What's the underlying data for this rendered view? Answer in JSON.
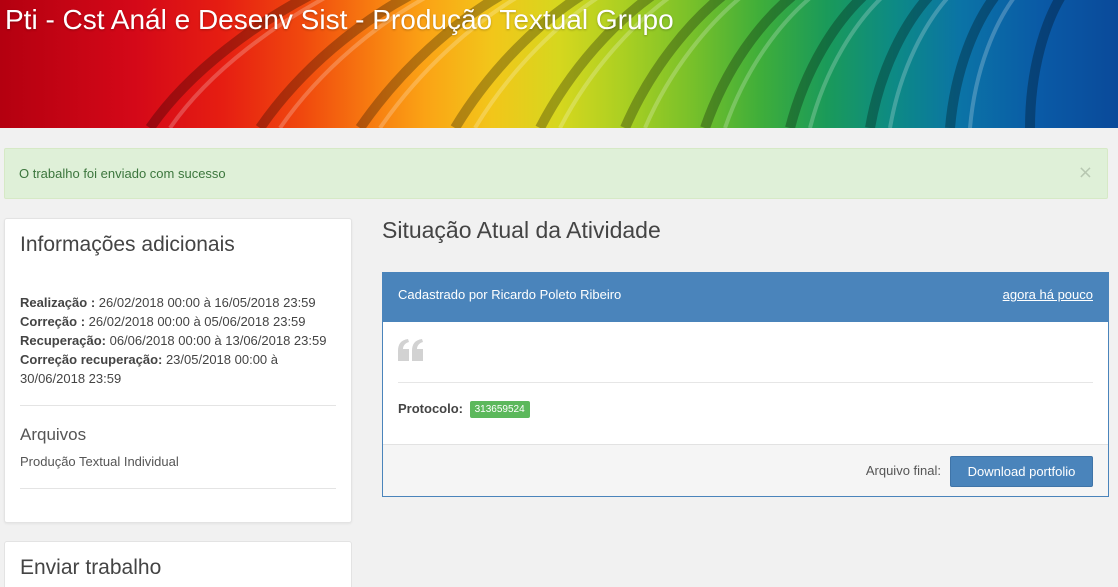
{
  "banner": {
    "title": "Pti - Cst Anál e Desenv Sist - Produção Textual Grupo"
  },
  "alert": {
    "message": "O trabalho foi enviado com sucesso",
    "close_glyph": "×"
  },
  "sidebar": {
    "info_title": "Informações adicionais",
    "dates": [
      {
        "label": "Realização :",
        "value": " 26/02/2018 00:00 à 16/05/2018 23:59"
      },
      {
        "label": "Correção :",
        "value": " 26/02/2018 00:00 à 05/06/2018 23:59"
      },
      {
        "label": "Recuperação:",
        "value": " 06/06/2018 00:00 à 13/06/2018 23:59"
      },
      {
        "label": "Correção recuperação:",
        "value": " 23/05/2018 00:00 à 30/06/2018 23:59"
      }
    ],
    "files_title": "Arquivos",
    "file_name": "Produção Textual Individual",
    "send_title": "Enviar trabalho"
  },
  "main": {
    "title": "Situação Atual da Atividade",
    "card": {
      "author": "Cadastrado por Ricardo Poleto Ribeiro",
      "time": "agora há pouco",
      "quote_icon": "quote-left-icon",
      "protocol_label": "Protocolo:",
      "protocol_value": "313659524",
      "final_file_label": "Arquivo final:",
      "download_label": "Download portfolio"
    }
  },
  "colors": {
    "primary": "#4a84bb",
    "success_bg": "#dff0d8",
    "success_text": "#3c763d",
    "badge": "#5cb85c",
    "page_bg": "#f1f1f1"
  }
}
